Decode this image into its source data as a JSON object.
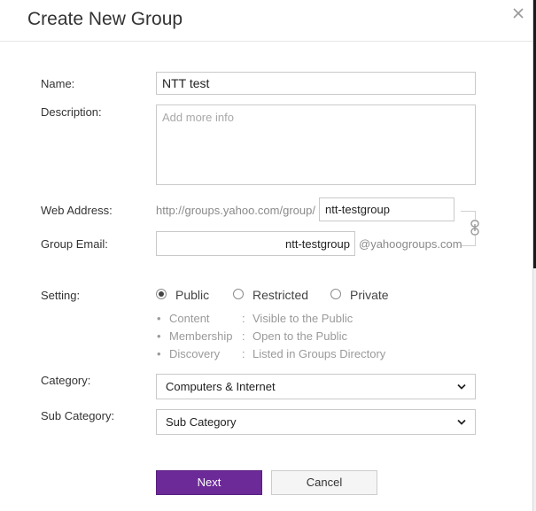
{
  "dialog": {
    "title": "Create New Group",
    "close_icon": "close-icon"
  },
  "form": {
    "name": {
      "label": "Name:",
      "value": "NTT test"
    },
    "description": {
      "label": "Description:",
      "placeholder": "Add more info"
    },
    "web_address": {
      "label": "Web Address:",
      "prefix": "http://groups.yahoo.com/group/",
      "value": "ntt-testgroup"
    },
    "group_email": {
      "label": "Group Email:",
      "value": "ntt-testgroup",
      "suffix": "@yahoogroups.com"
    },
    "link_icon": "link-icon",
    "setting": {
      "label": "Setting:",
      "options": [
        {
          "label": "Public",
          "selected": true
        },
        {
          "label": "Restricted",
          "selected": false
        },
        {
          "label": "Private",
          "selected": false
        }
      ],
      "details": [
        {
          "key": "Content",
          "value": "Visible to the Public"
        },
        {
          "key": "Membership",
          "value": "Open to the Public"
        },
        {
          "key": "Discovery",
          "value": "Listed in Groups Directory"
        }
      ],
      "bullet": "•",
      "separator": ":"
    },
    "category": {
      "label": "Category:",
      "selected": "Computers & Internet"
    },
    "sub_category": {
      "label": "Sub Category:",
      "selected": "Sub Category"
    }
  },
  "buttons": {
    "next": "Next",
    "cancel": "Cancel"
  },
  "colors": {
    "primary_button": "#6c2a98",
    "muted_text": "#8a8a8a"
  }
}
